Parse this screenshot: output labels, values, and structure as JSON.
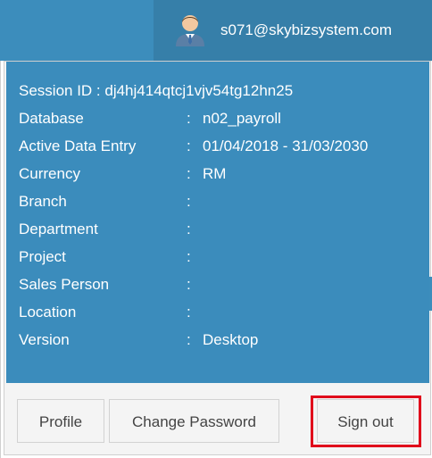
{
  "header": {
    "user_email": "s071@skybizsystem.com",
    "avatar_icon": "user-avatar-icon"
  },
  "session": {
    "label": "Session ID",
    "value": "dj4hj414qtcj1vjv54tg12hn25"
  },
  "info_rows": [
    {
      "label": "Database",
      "value": "n02_payroll"
    },
    {
      "label": "Active Data Entry",
      "value": "01/04/2018 - 31/03/2030"
    },
    {
      "label": "Currency",
      "value": "RM"
    },
    {
      "label": "Branch",
      "value": ""
    },
    {
      "label": "Department",
      "value": ""
    },
    {
      "label": "Project",
      "value": ""
    },
    {
      "label": "Sales Person",
      "value": ""
    },
    {
      "label": "Location",
      "value": ""
    },
    {
      "label": "Version",
      "value": "Desktop"
    }
  ],
  "colon": ":",
  "footer": {
    "profile_label": "Profile",
    "change_password_label": "Change Password",
    "sign_out_label": "Sign out"
  },
  "colors": {
    "header_bg": "#3c8dbc",
    "highlight": "#e0061b"
  }
}
